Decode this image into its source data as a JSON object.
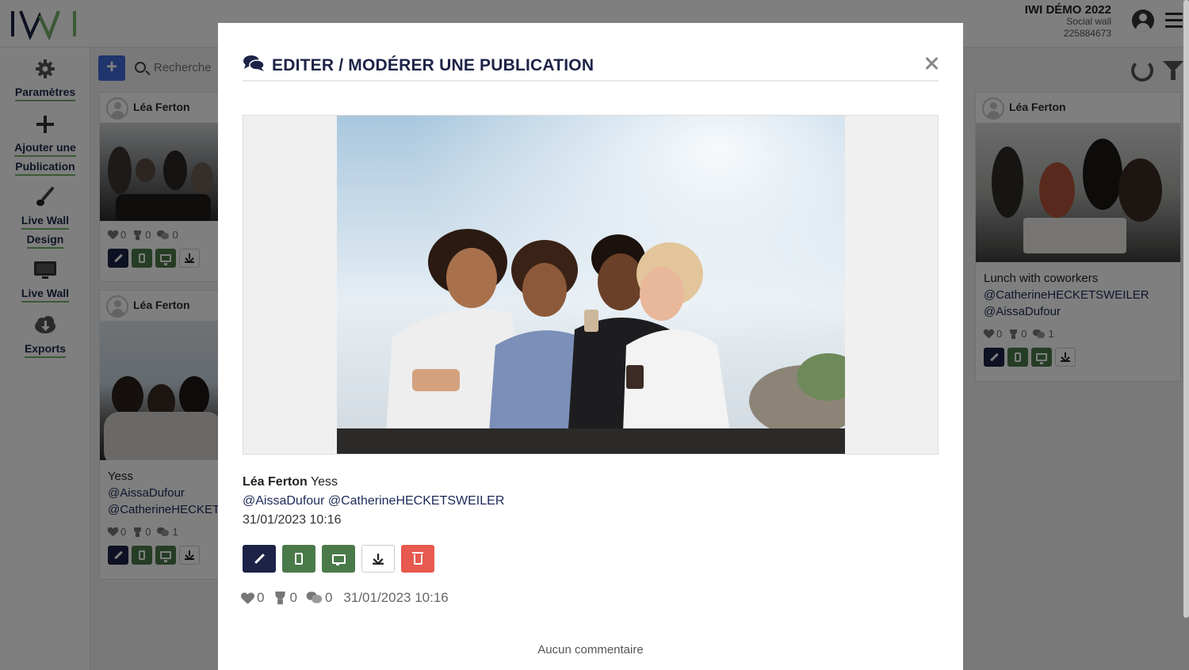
{
  "app": {
    "logo_text": "IWI",
    "event_name": "IWI DÉMO 2022",
    "event_type": "Social wall",
    "event_id": "225884673"
  },
  "sidebar": {
    "items": [
      {
        "label_line1": "Paramètres",
        "label_line2": ""
      },
      {
        "label_line1": "Ajouter une",
        "label_line2": "Publication"
      },
      {
        "label_line1": "Live Wall",
        "label_line2": "Design"
      },
      {
        "label_line1": "Live Wall",
        "label_line2": ""
      },
      {
        "label_line1": "Exports",
        "label_line2": ""
      }
    ]
  },
  "toolbar": {
    "add_label": "+",
    "search_placeholder": "Recherche"
  },
  "cards": [
    {
      "author": "Léa Ferton",
      "text": "",
      "likes": "0",
      "trophies": "0",
      "comments": "0"
    },
    {
      "author": "Léa Ferton",
      "text_line1": "Yess",
      "text_line2": "@AissaDufour",
      "text_line3": "@CatherineHECKETSWEILER",
      "likes": "0",
      "trophies": "0",
      "comments": "1"
    },
    {
      "author": "Léa Ferton",
      "text_line1": "Lunch with coworkers",
      "text_line2": "@CatherineHECKETSWEILER",
      "text_line3": "@AissaDufour",
      "likes": "0",
      "trophies": "0",
      "comments": "1"
    }
  ],
  "modal": {
    "title": "EDITER / MODÉRER UNE PUBLICATION",
    "author": "Léa Ferton",
    "text": "Yess",
    "mentions": "@AissaDufour @CatherineHECKETSWEILER",
    "date": "31/01/2023 10:16",
    "likes": "0",
    "trophies": "0",
    "comments": "0",
    "stats_date": "31/01/2023 10:16",
    "no_comment": "Aucun commentaire"
  },
  "colors": {
    "navy": "#1c2346",
    "green": "#4b7a4a",
    "red": "#e8594f",
    "accent_blue": "#3f6ad8",
    "underline_green": "#76b36b"
  }
}
